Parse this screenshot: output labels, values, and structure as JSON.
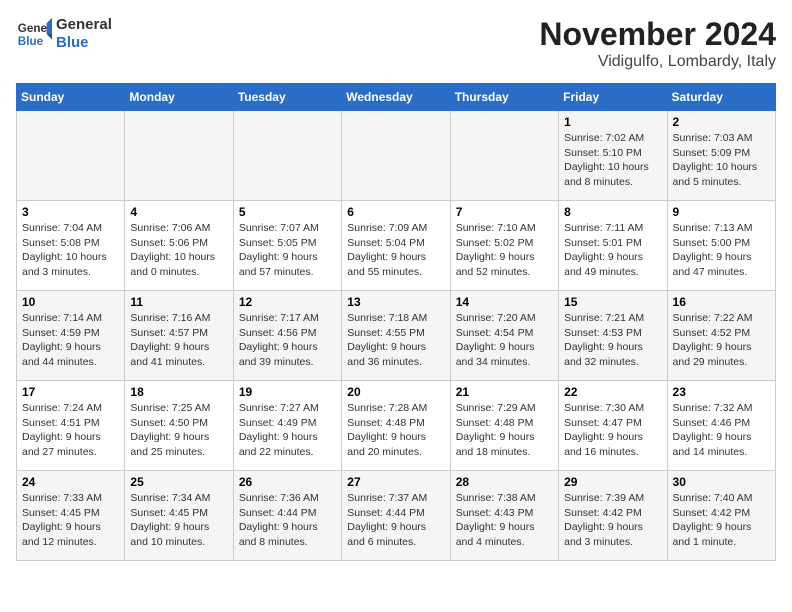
{
  "logo": {
    "text_general": "General",
    "text_blue": "Blue"
  },
  "title": "November 2024",
  "subtitle": "Vidigulfo, Lombardy, Italy",
  "days_of_week": [
    "Sunday",
    "Monday",
    "Tuesday",
    "Wednesday",
    "Thursday",
    "Friday",
    "Saturday"
  ],
  "weeks": [
    [
      {
        "day": "",
        "info": ""
      },
      {
        "day": "",
        "info": ""
      },
      {
        "day": "",
        "info": ""
      },
      {
        "day": "",
        "info": ""
      },
      {
        "day": "",
        "info": ""
      },
      {
        "day": "1",
        "info": "Sunrise: 7:02 AM\nSunset: 5:10 PM\nDaylight: 10 hours and 8 minutes."
      },
      {
        "day": "2",
        "info": "Sunrise: 7:03 AM\nSunset: 5:09 PM\nDaylight: 10 hours and 5 minutes."
      }
    ],
    [
      {
        "day": "3",
        "info": "Sunrise: 7:04 AM\nSunset: 5:08 PM\nDaylight: 10 hours and 3 minutes."
      },
      {
        "day": "4",
        "info": "Sunrise: 7:06 AM\nSunset: 5:06 PM\nDaylight: 10 hours and 0 minutes."
      },
      {
        "day": "5",
        "info": "Sunrise: 7:07 AM\nSunset: 5:05 PM\nDaylight: 9 hours and 57 minutes."
      },
      {
        "day": "6",
        "info": "Sunrise: 7:09 AM\nSunset: 5:04 PM\nDaylight: 9 hours and 55 minutes."
      },
      {
        "day": "7",
        "info": "Sunrise: 7:10 AM\nSunset: 5:02 PM\nDaylight: 9 hours and 52 minutes."
      },
      {
        "day": "8",
        "info": "Sunrise: 7:11 AM\nSunset: 5:01 PM\nDaylight: 9 hours and 49 minutes."
      },
      {
        "day": "9",
        "info": "Sunrise: 7:13 AM\nSunset: 5:00 PM\nDaylight: 9 hours and 47 minutes."
      }
    ],
    [
      {
        "day": "10",
        "info": "Sunrise: 7:14 AM\nSunset: 4:59 PM\nDaylight: 9 hours and 44 minutes."
      },
      {
        "day": "11",
        "info": "Sunrise: 7:16 AM\nSunset: 4:57 PM\nDaylight: 9 hours and 41 minutes."
      },
      {
        "day": "12",
        "info": "Sunrise: 7:17 AM\nSunset: 4:56 PM\nDaylight: 9 hours and 39 minutes."
      },
      {
        "day": "13",
        "info": "Sunrise: 7:18 AM\nSunset: 4:55 PM\nDaylight: 9 hours and 36 minutes."
      },
      {
        "day": "14",
        "info": "Sunrise: 7:20 AM\nSunset: 4:54 PM\nDaylight: 9 hours and 34 minutes."
      },
      {
        "day": "15",
        "info": "Sunrise: 7:21 AM\nSunset: 4:53 PM\nDaylight: 9 hours and 32 minutes."
      },
      {
        "day": "16",
        "info": "Sunrise: 7:22 AM\nSunset: 4:52 PM\nDaylight: 9 hours and 29 minutes."
      }
    ],
    [
      {
        "day": "17",
        "info": "Sunrise: 7:24 AM\nSunset: 4:51 PM\nDaylight: 9 hours and 27 minutes."
      },
      {
        "day": "18",
        "info": "Sunrise: 7:25 AM\nSunset: 4:50 PM\nDaylight: 9 hours and 25 minutes."
      },
      {
        "day": "19",
        "info": "Sunrise: 7:27 AM\nSunset: 4:49 PM\nDaylight: 9 hours and 22 minutes."
      },
      {
        "day": "20",
        "info": "Sunrise: 7:28 AM\nSunset: 4:48 PM\nDaylight: 9 hours and 20 minutes."
      },
      {
        "day": "21",
        "info": "Sunrise: 7:29 AM\nSunset: 4:48 PM\nDaylight: 9 hours and 18 minutes."
      },
      {
        "day": "22",
        "info": "Sunrise: 7:30 AM\nSunset: 4:47 PM\nDaylight: 9 hours and 16 minutes."
      },
      {
        "day": "23",
        "info": "Sunrise: 7:32 AM\nSunset: 4:46 PM\nDaylight: 9 hours and 14 minutes."
      }
    ],
    [
      {
        "day": "24",
        "info": "Sunrise: 7:33 AM\nSunset: 4:45 PM\nDaylight: 9 hours and 12 minutes."
      },
      {
        "day": "25",
        "info": "Sunrise: 7:34 AM\nSunset: 4:45 PM\nDaylight: 9 hours and 10 minutes."
      },
      {
        "day": "26",
        "info": "Sunrise: 7:36 AM\nSunset: 4:44 PM\nDaylight: 9 hours and 8 minutes."
      },
      {
        "day": "27",
        "info": "Sunrise: 7:37 AM\nSunset: 4:44 PM\nDaylight: 9 hours and 6 minutes."
      },
      {
        "day": "28",
        "info": "Sunrise: 7:38 AM\nSunset: 4:43 PM\nDaylight: 9 hours and 4 minutes."
      },
      {
        "day": "29",
        "info": "Sunrise: 7:39 AM\nSunset: 4:42 PM\nDaylight: 9 hours and 3 minutes."
      },
      {
        "day": "30",
        "info": "Sunrise: 7:40 AM\nSunset: 4:42 PM\nDaylight: 9 hours and 1 minute."
      }
    ]
  ]
}
